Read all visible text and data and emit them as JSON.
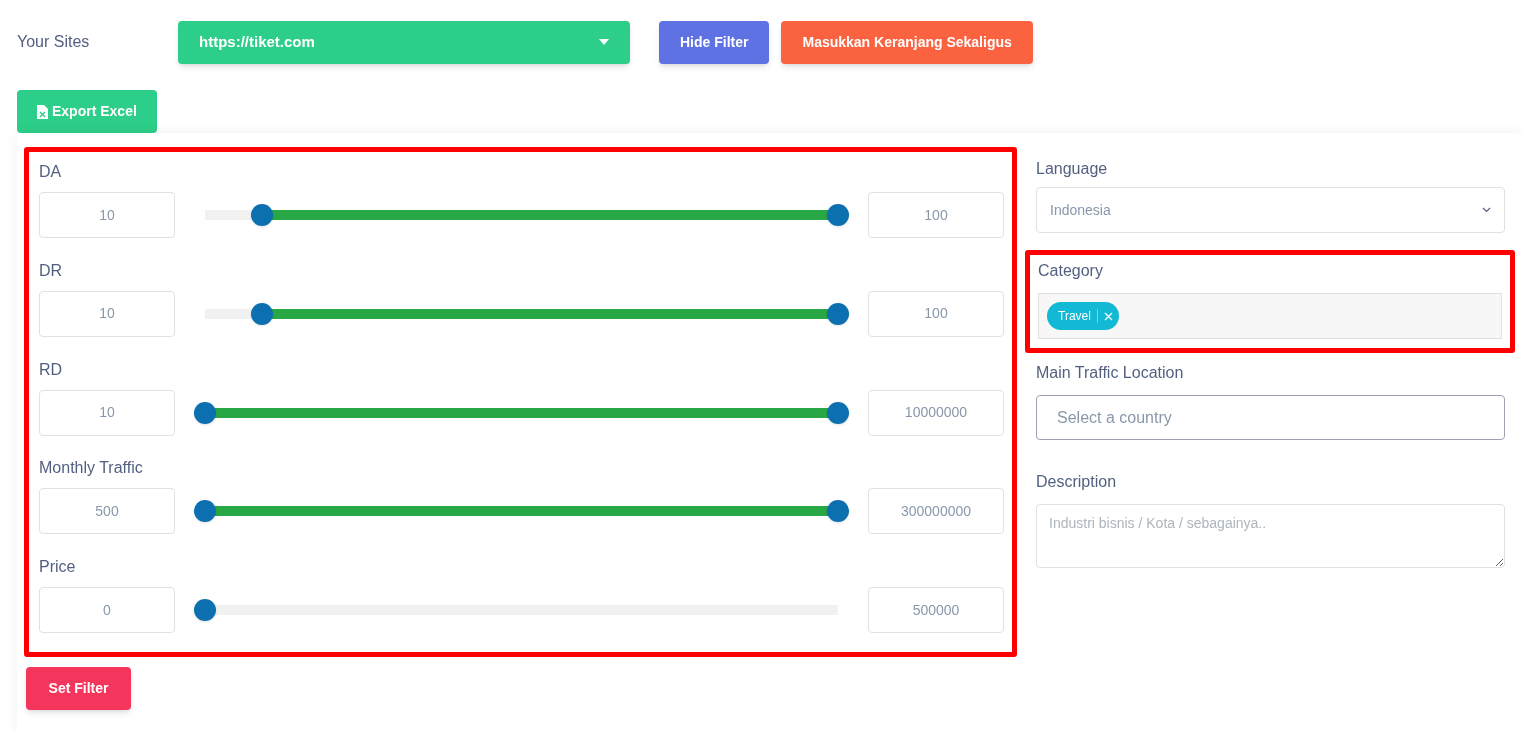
{
  "header": {
    "sites_label": "Your Sites",
    "site_select": {
      "value": "https://tiket.com"
    },
    "buttons": [
      {
        "label": "Hide Filter",
        "kind": "primary"
      },
      {
        "label": "Masukkan Keranjang Sekaligus",
        "kind": "warning"
      }
    ]
  },
  "export_button": {
    "label": "Export Excel"
  },
  "range_filters": {
    "highlighted": true,
    "items": [
      {
        "label": "DA",
        "min": "10",
        "max": "100",
        "thumbs": [
          {
            "level": 0.09
          },
          {
            "level": 1
          }
        ]
      },
      {
        "label": "DR",
        "min": "10",
        "max": "100",
        "thumbs": [
          {
            "level": 0.09
          },
          {
            "level": 1
          }
        ]
      },
      {
        "label": "RD",
        "min": "10",
        "max": "10000000",
        "thumbs": [
          {
            "level": 0
          },
          {
            "level": 1
          }
        ]
      },
      {
        "label": "Monthly Traffic",
        "min": "500",
        "max": "300000000",
        "thumbs": [
          {
            "level": 0
          },
          {
            "level": 1
          }
        ]
      },
      {
        "label": "Price",
        "min": "0",
        "max": "500000",
        "thumbs": [
          {
            "level": 0
          }
        ]
      }
    ]
  },
  "language": {
    "label": "Language",
    "value": "Indonesia"
  },
  "category": {
    "label": "Category",
    "highlighted": true,
    "tags": [
      "Travel"
    ]
  },
  "traffic_location": {
    "label": "Main Traffic Location",
    "placeholder": "Select a country"
  },
  "description": {
    "label": "Description",
    "placeholder": "Industri bisnis / Kota / sebagainya.."
  },
  "set_filter_button": {
    "label": "Set Filter"
  }
}
